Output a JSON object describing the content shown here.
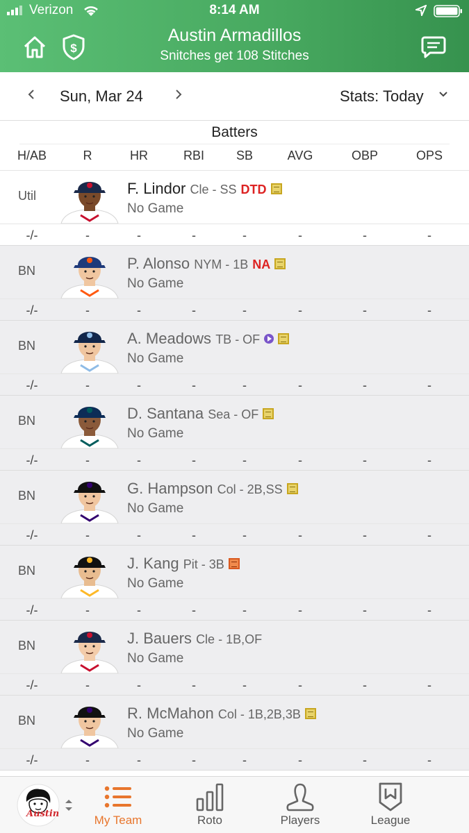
{
  "status_bar": {
    "carrier": "Verizon",
    "time": "8:14 AM"
  },
  "header": {
    "title": "Austin Armadillos",
    "subtitle": "Snitches get 108 Stitches"
  },
  "date_bar": {
    "date": "Sun, Mar 24",
    "stats_select": "Stats: Today"
  },
  "table": {
    "section_title": "Batters",
    "columns": [
      "H/AB",
      "R",
      "HR",
      "RBI",
      "SB",
      "AVG",
      "OBP",
      "OPS"
    ],
    "rows": [
      {
        "slot": "Util",
        "name": "F. Lindor",
        "team_pos": "Cle - SS",
        "tag": "DTD",
        "icon": "note-icon",
        "status": "No Game",
        "stats": [
          "-/-",
          "-",
          "-",
          "-",
          "-",
          "-",
          "-",
          "-"
        ],
        "cap_color": "#1b2a4a",
        "accent": "#c8102e",
        "skin": "#7a4a2a"
      },
      {
        "slot": "BN",
        "name": "P. Alonso",
        "team_pos": "NYM - 1B",
        "tag": "NA",
        "icon": "note-icon",
        "status": "No Game",
        "stats": [
          "-/-",
          "-",
          "-",
          "-",
          "-",
          "-",
          "-",
          "-"
        ],
        "cap_color": "#1f3a7a",
        "accent": "#ff5910",
        "skin": "#f0c6a0"
      },
      {
        "slot": "BN",
        "name": "A. Meadows",
        "team_pos": "TB - OF",
        "tag": "",
        "icon": "note-icon",
        "status": "No Game",
        "stats": [
          "-/-",
          "-",
          "-",
          "-",
          "-",
          "-",
          "-",
          "-"
        ],
        "cap_color": "#12264a",
        "accent": "#8fbce6",
        "skin": "#f0c6a0"
      },
      {
        "slot": "BN",
        "name": "D. Santana",
        "team_pos": "Sea - OF",
        "tag": "",
        "icon": "note-icon",
        "status": "No Game",
        "stats": [
          "-/-",
          "-",
          "-",
          "-",
          "-",
          "-",
          "-",
          "-"
        ],
        "cap_color": "#0c2c56",
        "accent": "#005c5c",
        "skin": "#8a5a3a"
      },
      {
        "slot": "BN",
        "name": "G. Hampson",
        "team_pos": "Col - 2B,SS",
        "tag": "",
        "icon": "note-icon",
        "status": "No Game",
        "stats": [
          "-/-",
          "-",
          "-",
          "-",
          "-",
          "-",
          "-",
          "-"
        ],
        "cap_color": "#111111",
        "accent": "#33006f",
        "skin": "#f0c6a0"
      },
      {
        "slot": "BN",
        "name": "J. Kang",
        "team_pos": "Pit - 3B",
        "tag": "",
        "icon": "note-orange-icon",
        "status": "No Game",
        "stats": [
          "-/-",
          "-",
          "-",
          "-",
          "-",
          "-",
          "-",
          "-"
        ],
        "cap_color": "#111111",
        "accent": "#fdb827",
        "skin": "#e8bc90"
      },
      {
        "slot": "BN",
        "name": "J. Bauers",
        "team_pos": "Cle - 1B,OF",
        "tag": "",
        "icon": "",
        "status": "No Game",
        "stats": [
          "-/-",
          "-",
          "-",
          "-",
          "-",
          "-",
          "-",
          "-"
        ],
        "cap_color": "#1b2a4a",
        "accent": "#c8102e",
        "skin": "#f3ccaa"
      },
      {
        "slot": "BN",
        "name": "R. McMahon",
        "team_pos": "Col - 1B,2B,3B",
        "tag": "",
        "icon": "note-icon",
        "status": "No Game",
        "stats": [
          "-/-",
          "-",
          "-",
          "-",
          "-",
          "-",
          "-",
          "-"
        ],
        "cap_color": "#111111",
        "accent": "#33006f",
        "skin": "#f0c6a0"
      }
    ]
  },
  "tab_bar": {
    "avatar_label": "Austin",
    "tabs": [
      {
        "label": "My Team",
        "icon": "list-icon",
        "active": true
      },
      {
        "label": "Roto",
        "icon": "bar-chart-icon",
        "active": false
      },
      {
        "label": "Players",
        "icon": "player-icon",
        "active": false
      },
      {
        "label": "League",
        "icon": "shield-icon",
        "active": false
      }
    ]
  },
  "colors": {
    "header_green": "#47a85f",
    "active_tab": "#e8762d",
    "dtd_red": "#d22222",
    "note_yellow": "#e8d36a"
  }
}
